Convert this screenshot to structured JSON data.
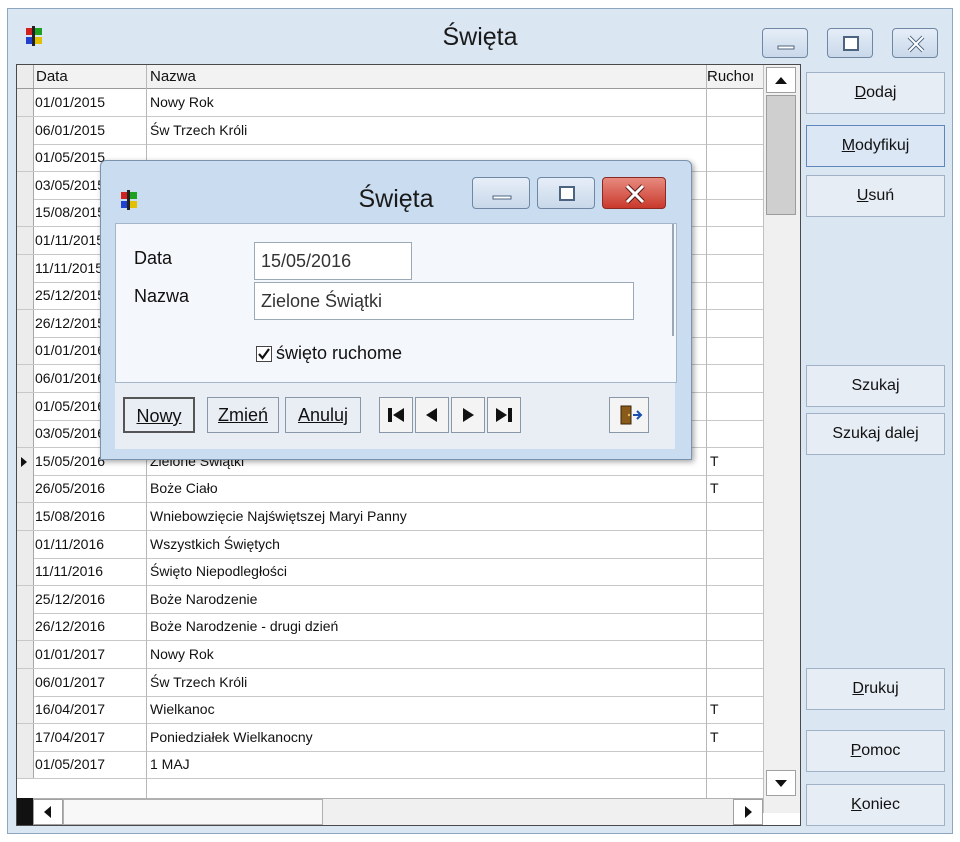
{
  "window": {
    "title": "Święta"
  },
  "grid": {
    "headers": [
      "Data",
      "Nazwa",
      "Ruchome"
    ],
    "rows": [
      [
        "01/01/2015",
        "Nowy Rok",
        ""
      ],
      [
        "06/01/2015",
        "Św Trzech Króli",
        ""
      ],
      [
        "01/05/2015",
        "",
        ""
      ],
      [
        "03/05/2015",
        "",
        ""
      ],
      [
        "15/08/2015",
        "",
        ""
      ],
      [
        "01/11/2015",
        "",
        ""
      ],
      [
        "11/11/2015",
        "",
        ""
      ],
      [
        "25/12/2015",
        "",
        ""
      ],
      [
        "26/12/2015",
        "",
        ""
      ],
      [
        "01/01/2016",
        "",
        ""
      ],
      [
        "06/01/2016",
        "",
        ""
      ],
      [
        "01/05/2016",
        "",
        ""
      ],
      [
        "03/05/2016",
        "",
        ""
      ],
      [
        "15/05/2016",
        "Zielone Świątki",
        "T"
      ],
      [
        "26/05/2016",
        "Boże Ciało",
        "T"
      ],
      [
        "15/08/2016",
        "Wniebowzięcie Najświętszej Maryi Panny",
        ""
      ],
      [
        "01/11/2016",
        "Wszystkich Świętych",
        ""
      ],
      [
        "11/11/2016",
        "Święto Niepodległości",
        ""
      ],
      [
        "25/12/2016",
        "Boże Narodzenie",
        ""
      ],
      [
        "26/12/2016",
        "Boże Narodzenie - drugi dzień",
        ""
      ],
      [
        "01/01/2017",
        "Nowy Rok",
        ""
      ],
      [
        "06/01/2017",
        "Św Trzech Króli",
        ""
      ],
      [
        "16/04/2017",
        "Wielkanoc",
        "T"
      ],
      [
        "17/04/2017",
        "Poniedziałek Wielkanocny",
        "T"
      ],
      [
        "01/05/2017",
        "1 MAJ",
        ""
      ]
    ],
    "current_row": "15/05/2016"
  },
  "side_buttons": [
    {
      "label": "Dodaj",
      "underline_first": true
    },
    {
      "label": "Modyfikuj",
      "underline_first": true
    },
    {
      "label": "Usuń",
      "underline_first": true
    },
    {
      "label": "Szukaj",
      "underline_first": false
    },
    {
      "label": "Szukaj dalej",
      "underline_first": false
    },
    {
      "label": "Drukuj",
      "underline_first": true
    },
    {
      "label": "Pomoc",
      "underline_first": true
    },
    {
      "label": "Koniec",
      "underline_first": true
    }
  ],
  "dialog": {
    "title": "Święta",
    "date_label": "Data",
    "date_value": "15/05/2016",
    "name_label": "Nazwa",
    "name_value": "Zielone Świątki",
    "checkbox_label": "święto ruchome",
    "checkbox_checked": true,
    "buttons": {
      "new": "Nowy",
      "change": "Zmień",
      "cancel": "Anuluj"
    },
    "nav_icons": [
      "first-record-icon",
      "prev-record-icon",
      "next-record-icon",
      "last-record-icon"
    ],
    "exit_icon": "exit-door-icon"
  },
  "colors": {
    "window_bg": "#dbe6f3",
    "close_red": "#d9453a"
  }
}
